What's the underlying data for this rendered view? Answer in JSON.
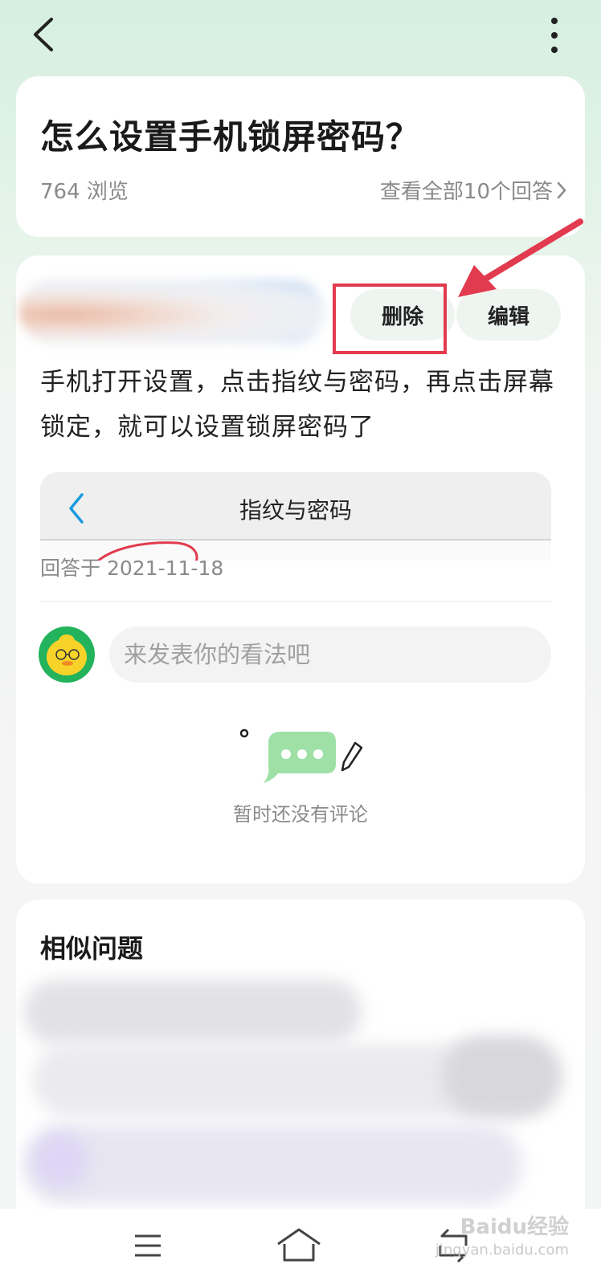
{
  "question": {
    "title": "怎么设置手机锁屏密码？",
    "views": "764 浏览",
    "view_all": "查看全部10个回答"
  },
  "answer": {
    "delete_label": "删除",
    "edit_label": "编辑",
    "text": "手机打开设置，点击指纹与密码，再点击屏幕锁定，就可以设置锁屏密码了",
    "screenshot_title": "指纹与密码",
    "answered_at": "回答于 2021-11-18",
    "comment_placeholder": "来发表你的看法吧",
    "no_comments": "暂时还没有评论"
  },
  "similar": {
    "title": "相似问题"
  },
  "watermark": {
    "brand": "Baidu经验",
    "url": "jingyan.baidu.com"
  },
  "colors": {
    "accent_green": "#22b35c",
    "highlight_red": "#e23a4e",
    "button_bg": "#eef5f0"
  },
  "icons": [
    "back-arrow-icon",
    "more-vertical-icon",
    "chevron-right-icon",
    "red-arrow-annotation",
    "chat-bubble-icon",
    "pencil-icon",
    "menu-icon",
    "home-icon",
    "return-icon"
  ]
}
